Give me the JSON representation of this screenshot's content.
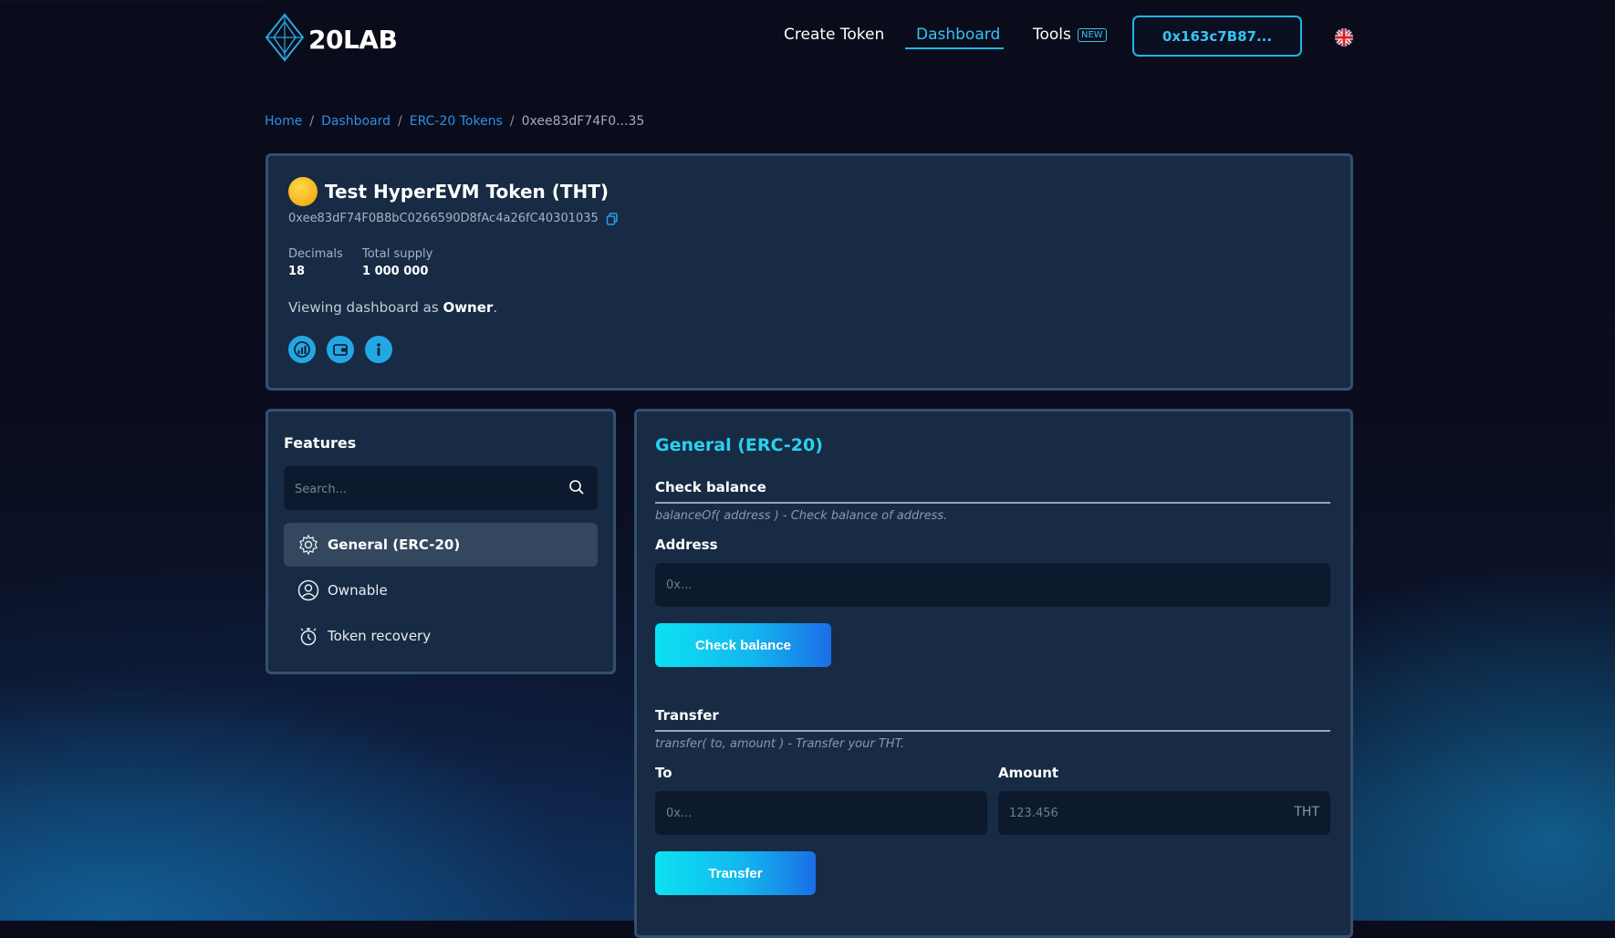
{
  "header": {
    "logo_text": "20LAB",
    "nav": {
      "create_token": "Create Token",
      "dashboard": "Dashboard",
      "tools": "Tools",
      "tools_badge": "NEW"
    },
    "wallet_address": "0x163c7B87...",
    "language_icon": "uk-flag-icon"
  },
  "breadcrumb": {
    "home": "Home",
    "dashboard": "Dashboard",
    "erc20": "ERC-20 Tokens",
    "current": "0xee83dF74F0...35",
    "separator": "/"
  },
  "token": {
    "title": "Test HyperEVM Token (THT)",
    "address": "0xee83dF74F0B8bC0266590D8fAc4a26fC40301035",
    "decimals_label": "Decimals",
    "decimals_value": "18",
    "supply_label": "Total supply",
    "supply_value": "1 000 000",
    "viewing_prefix": "Viewing dashboard as ",
    "viewing_role": "Owner",
    "viewing_suffix": ".",
    "action_icons": [
      "chart-icon",
      "wallet-icon",
      "info-icon"
    ]
  },
  "features": {
    "title": "Features",
    "search_placeholder": "Search...",
    "items": [
      {
        "label": "General (ERC-20)",
        "icon": "gear-icon",
        "active": true
      },
      {
        "label": "Ownable",
        "icon": "user-icon",
        "active": false
      },
      {
        "label": "Token recovery",
        "icon": "stopwatch-icon",
        "active": false
      }
    ]
  },
  "general": {
    "title": "General (ERC-20)",
    "check_balance": {
      "heading": "Check balance",
      "description": "balanceOf( address ) - Check balance of address.",
      "address_label": "Address",
      "address_placeholder": "0x...",
      "button": "Check balance"
    },
    "transfer": {
      "heading": "Transfer",
      "description": "transfer( to, amount ) - Transfer your THT.",
      "to_label": "To",
      "to_placeholder": "0x...",
      "amount_label": "Amount",
      "amount_placeholder": "123.456",
      "amount_suffix": "THT",
      "button": "Transfer"
    }
  },
  "colors": {
    "accent": "#1eb7e9",
    "card_bg": "#172b44",
    "page_bg": "#0a0c1b"
  }
}
